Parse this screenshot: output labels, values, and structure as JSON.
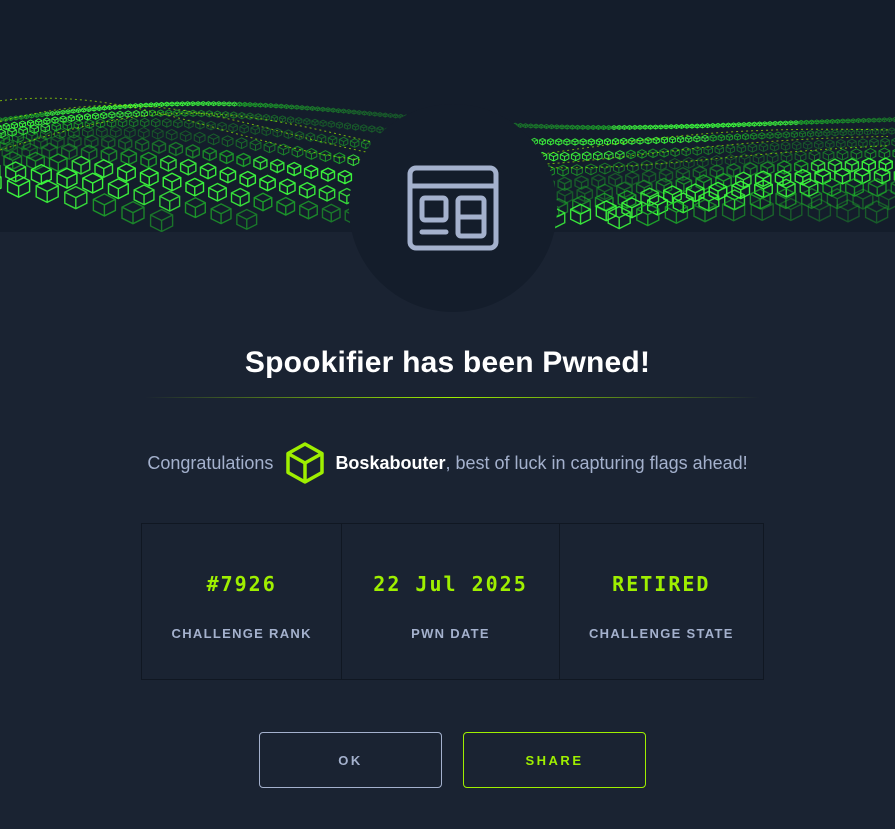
{
  "modal": {
    "title": "Spookifier has been Pwned!",
    "congrats_prefix": "Congratulations",
    "username": "Boskabouter",
    "congrats_suffix": ", best of luck in capturing flags ahead!",
    "badge_icon": "web-window-icon",
    "user_icon": "hackthebox-cube-icon"
  },
  "stats": [
    {
      "value": "#7926",
      "label": "CHALLENGE RANK"
    },
    {
      "value": "22 Jul 2025",
      "label": "PWN DATE"
    },
    {
      "value": "RETIRED",
      "label": "CHALLENGE STATE"
    }
  ],
  "buttons": {
    "ok_label": "OK",
    "share_label": "SHARE"
  },
  "colors": {
    "accent": "#9fef00",
    "background": "#1a2332",
    "header_background": "#141d2b",
    "muted_text": "#a4b1cd"
  }
}
